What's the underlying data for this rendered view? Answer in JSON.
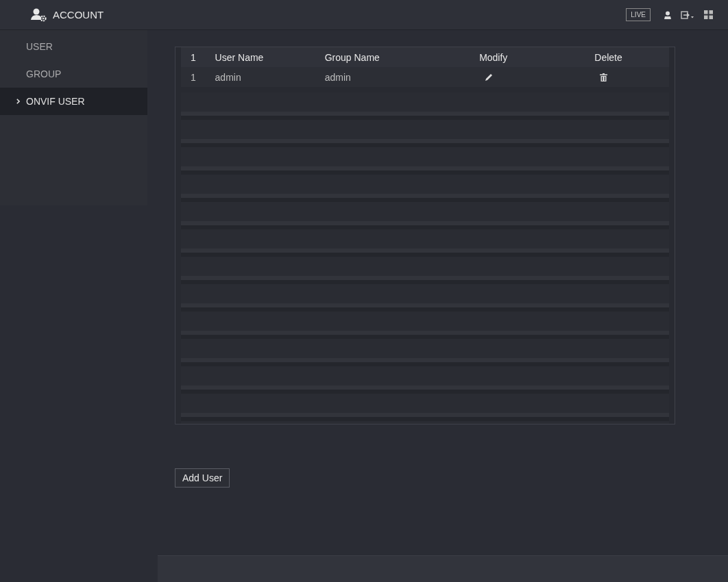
{
  "header": {
    "title": "ACCOUNT",
    "live_button": "LIVE"
  },
  "sidebar": {
    "items": [
      {
        "label": "USER",
        "selected": false
      },
      {
        "label": "GROUP",
        "selected": false
      },
      {
        "label": "ONVIF USER",
        "selected": true
      }
    ]
  },
  "table": {
    "columns": [
      "1",
      "User Name",
      "Group Name",
      "Modify",
      "Delete"
    ],
    "rows": [
      {
        "index": "1",
        "user_name": "admin",
        "group_name": "admin"
      }
    ]
  },
  "buttons": [
    "Add User"
  ]
}
